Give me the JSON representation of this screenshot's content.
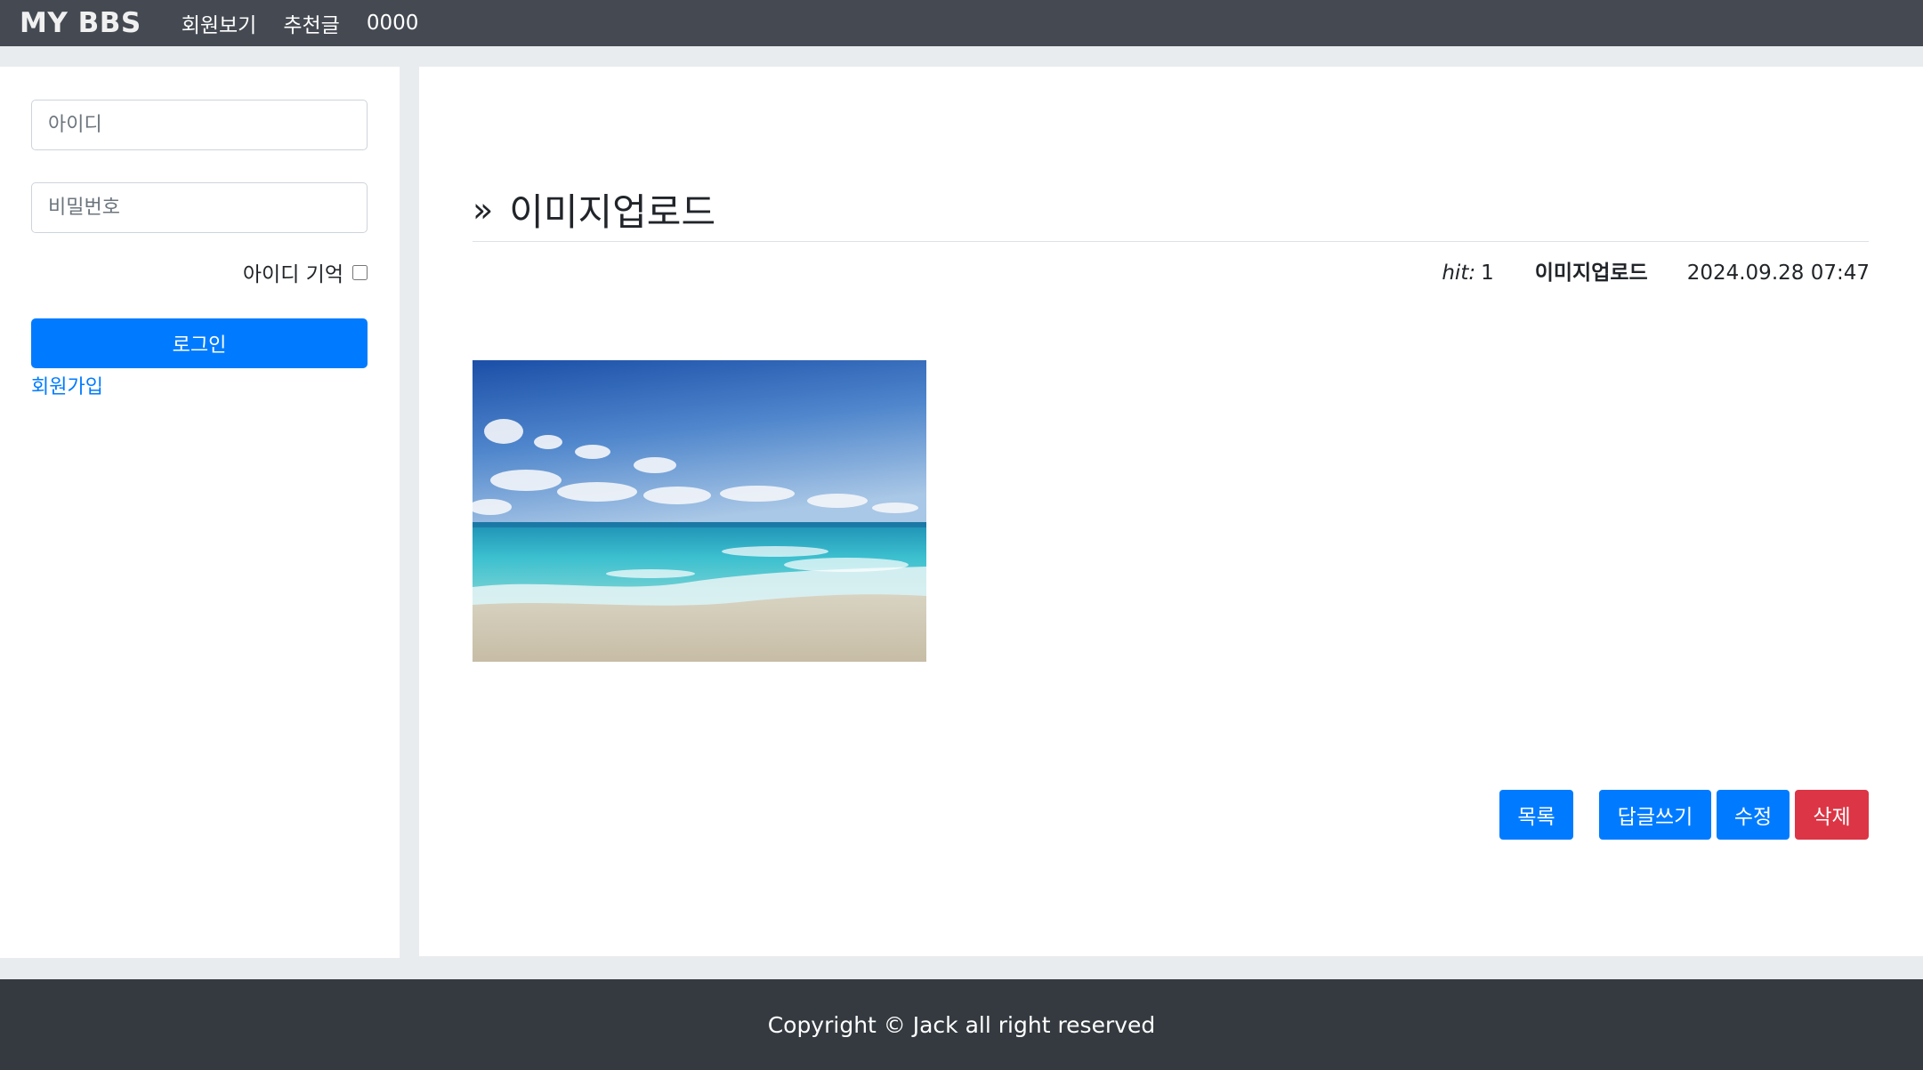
{
  "navbar": {
    "brand": "MY BBS",
    "links": [
      "회원보기",
      "추천글",
      "0000"
    ]
  },
  "sidebar": {
    "id_placeholder": "아이디",
    "pw_placeholder": "비밀번호",
    "remember_label": "아이디 기억",
    "login_label": "로그인",
    "signup_label": "회원가입"
  },
  "post": {
    "title_arrow": "»",
    "title": "이미지업로드",
    "hit_label": "hit:",
    "hit_count": "1",
    "author": "이미지업로드",
    "date": "2024.09.28 07:47"
  },
  "actions": {
    "list": "목록",
    "reply": "답글쓰기",
    "edit": "수정",
    "delete": "삭제"
  },
  "footer": {
    "copyright": "Copyright © Jack all right reserved"
  },
  "colors": {
    "navbar": "#454a52",
    "primary": "#007bff",
    "danger": "#dc3545",
    "footer": "#343a40"
  }
}
